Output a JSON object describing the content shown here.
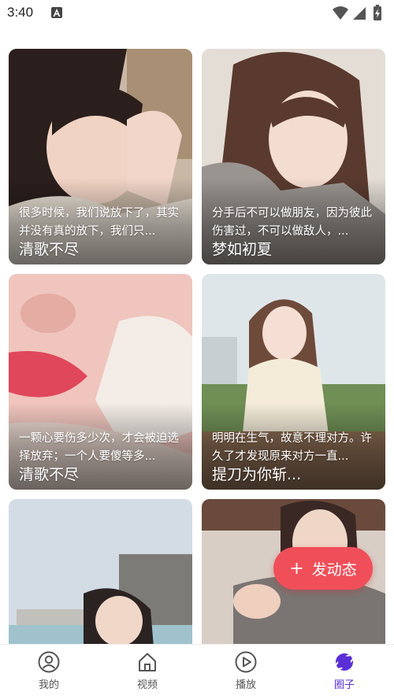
{
  "status_bar": {
    "time": "3:40"
  },
  "feed": [
    {
      "desc": "很多时候，我们说放下了，其实并没有真的放下，我们只...",
      "name": "清歌不尽"
    },
    {
      "desc": "分手后不可以做朋友，因为彼此伤害过，不可以做敌人，...",
      "name": "梦如初夏"
    },
    {
      "desc": "一颗心要伤多少次，才会被迫选择放弃；一个人要傻等多...",
      "name": "清歌不尽"
    },
    {
      "desc": "明明在生气，故意不理对方。许久了才发现原来对方一直...",
      "name": "提刀为你斩..."
    },
    {
      "desc": "",
      "name": ""
    },
    {
      "desc": "",
      "name": ""
    }
  ],
  "post_button": {
    "plus": "+",
    "label": "发动态"
  },
  "nav": {
    "items": [
      {
        "label": "我的",
        "icon": "person-icon"
      },
      {
        "label": "视频",
        "icon": "home-icon"
      },
      {
        "label": "播放",
        "icon": "play-icon"
      },
      {
        "label": "圈子",
        "icon": "circle-orbit-icon"
      }
    ],
    "active_index": 3
  },
  "colors": {
    "accent": "#f04f5a",
    "nav_active": "#5b2fd6",
    "nav_inactive": "#555555"
  }
}
